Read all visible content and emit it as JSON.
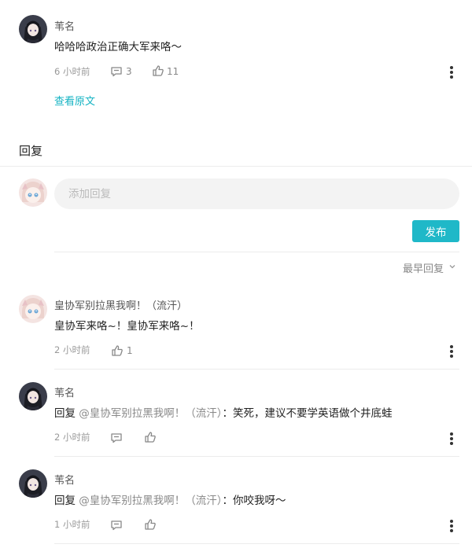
{
  "original_comment": {
    "author": "苇名",
    "text": "哈哈哈政治正确大军来咯～",
    "time": "6 小时前",
    "comment_count": "3",
    "like_count": "11",
    "view_original_label": "查看原文"
  },
  "replies_section": {
    "title": "回复",
    "input_placeholder": "添加回复",
    "publish_label": "发布",
    "sort_label": "最早回复"
  },
  "replies": [
    {
      "author": "皇协军别拉黑我啊！（流汗）",
      "text": "皇协军来咯~！皇协军来咯~！",
      "time": "2 小时前",
      "like_count": "1"
    },
    {
      "author": "苇名",
      "reply_prefix": "回复",
      "mention": "@皇协军别拉黑我啊！（流汗）",
      "text": "：笑死，建议不要学英语做个井底蛙",
      "time": "2 小时前"
    },
    {
      "author": "苇名",
      "reply_prefix": "回复",
      "mention": "@皇协军别拉黑我啊！（流汗）",
      "text": "：你咬我呀～",
      "time": "1 小时前"
    }
  ],
  "colors": {
    "accent": "#1fb8c8",
    "link": "#14b3c3"
  }
}
